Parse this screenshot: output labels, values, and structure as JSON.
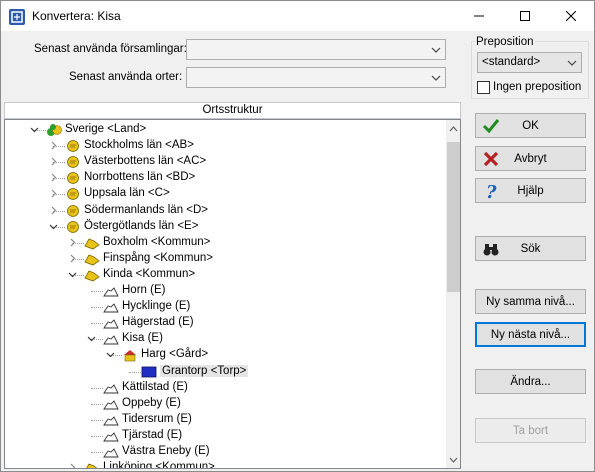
{
  "window": {
    "title": "Konvertera: Kisa"
  },
  "form": {
    "recent_parishes_label": "Senast använda församlingar:",
    "recent_places_label": "Senast använda orter:",
    "recent_parishes_value": "",
    "recent_places_value": ""
  },
  "preposition": {
    "group_label": "Preposition",
    "selected": "<standard>",
    "no_preposition_label": "Ingen preposition",
    "no_preposition_checked": false
  },
  "tree": {
    "header": "Ortsstruktur",
    "items": [
      {
        "label": "Sverige <Land>",
        "level": 0,
        "expander": "open",
        "icon": "country-icon"
      },
      {
        "label": "Stockholms län <AB>",
        "level": 1,
        "expander": "closed",
        "icon": "county-icon"
      },
      {
        "label": "Västerbottens län <AC>",
        "level": 1,
        "expander": "closed",
        "icon": "county-icon"
      },
      {
        "label": "Norrbottens län <BD>",
        "level": 1,
        "expander": "closed",
        "icon": "county-icon"
      },
      {
        "label": "Uppsala län <C>",
        "level": 1,
        "expander": "closed",
        "icon": "county-icon"
      },
      {
        "label": "Södermanlands län <D>",
        "level": 1,
        "expander": "closed",
        "icon": "county-icon"
      },
      {
        "label": "Östergötlands län <E>",
        "level": 1,
        "expander": "open",
        "icon": "county-icon"
      },
      {
        "label": "Boxholm <Kommun>",
        "level": 2,
        "expander": "closed",
        "icon": "municipality-icon"
      },
      {
        "label": "Finspång <Kommun>",
        "level": 2,
        "expander": "closed",
        "icon": "municipality-icon"
      },
      {
        "label": "Kinda <Kommun>",
        "level": 2,
        "expander": "open",
        "icon": "municipality-icon"
      },
      {
        "label": "Horn (E)",
        "level": 3,
        "expander": "none",
        "icon": "parish-icon"
      },
      {
        "label": "Hycklinge (E)",
        "level": 3,
        "expander": "none",
        "icon": "parish-icon"
      },
      {
        "label": "Hägerstad (E)",
        "level": 3,
        "expander": "none",
        "icon": "parish-icon"
      },
      {
        "label": "Kisa (E)",
        "level": 3,
        "expander": "open",
        "icon": "parish-icon"
      },
      {
        "label": "Harg <Gård>",
        "level": 4,
        "expander": "open",
        "icon": "farm-icon"
      },
      {
        "label": "Grantorp <Torp>",
        "level": 5,
        "expander": "none",
        "icon": "croft-icon",
        "selected": true
      },
      {
        "label": "Kättilstad (E)",
        "level": 3,
        "expander": "none",
        "icon": "parish-icon"
      },
      {
        "label": "Oppeby (E)",
        "level": 3,
        "expander": "none",
        "icon": "parish-icon"
      },
      {
        "label": "Tidersrum (E)",
        "level": 3,
        "expander": "none",
        "icon": "parish-icon"
      },
      {
        "label": "Tjärstad (E)",
        "level": 3,
        "expander": "none",
        "icon": "parish-icon"
      },
      {
        "label": "Västra Eneby (E)",
        "level": 3,
        "expander": "none",
        "icon": "parish-icon"
      },
      {
        "label": "Linköping <Kommun>",
        "level": 2,
        "expander": "closed",
        "icon": "municipality-icon"
      }
    ]
  },
  "buttons": {
    "ok": "OK",
    "cancel": "Avbryt",
    "help": "Hjälp",
    "search": "Sök",
    "new_same_level": "Ny samma nivå...",
    "new_next_level": "Ny nästa nivå...",
    "edit": "Ändra...",
    "delete": "Ta bort"
  },
  "colors": {
    "ok_icon": "#1e8c1e",
    "cancel_icon": "#b22222",
    "help_icon": "#1c5fb5",
    "focus_border": "#0078d7",
    "county_icon": "#e8c31a",
    "croft_icon": "#1f2fc2"
  }
}
